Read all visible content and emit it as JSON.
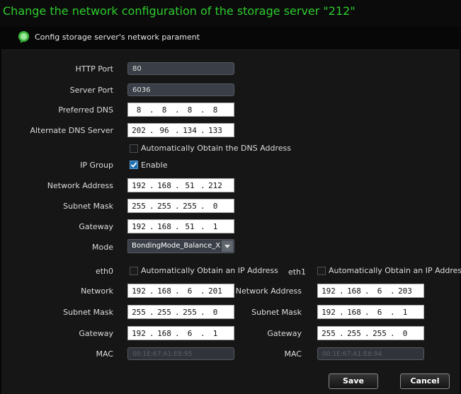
{
  "window": {
    "title": "Change the network configuration of the storage server \"212\""
  },
  "subheader": {
    "text": "Config storage server's network parament"
  },
  "form": {
    "http_port": {
      "label": "HTTP Port",
      "value": "80"
    },
    "server_port": {
      "label": "Server Port",
      "value": "6036"
    },
    "preferred_dns": {
      "label": "Preferred DNS",
      "octets": [
        "8",
        "8",
        "8",
        "8"
      ]
    },
    "alternate_dns": {
      "label": "Alternate DNS Server",
      "octets": [
        "202",
        "96",
        "134",
        "133"
      ]
    },
    "auto_dns": {
      "label": "Automatically Obtain the DNS Address",
      "checked": false
    },
    "ip_group": {
      "label": "IP Group",
      "enable_label": "Enable",
      "checked": true
    },
    "network_address": {
      "label": "Network Address",
      "octets": [
        "192",
        "168",
        "51",
        "212"
      ]
    },
    "subnet_mask": {
      "label": "Subnet Mask",
      "octets": [
        "255",
        "255",
        "255",
        "0"
      ]
    },
    "gateway": {
      "label": "Gateway",
      "octets": [
        "192",
        "168",
        "51",
        "1"
      ]
    },
    "mode": {
      "label": "Mode",
      "value": "BondingMode_Balance_X"
    }
  },
  "eth0": {
    "label": "eth0",
    "auto_ip": {
      "label": "Automatically Obtain an IP Address",
      "checked": false
    },
    "network": {
      "label": "Network",
      "octets": [
        "192",
        "168",
        "6",
        "201"
      ]
    },
    "subnet_mask": {
      "label": "Subnet Mask",
      "octets": [
        "255",
        "255",
        "255",
        "0"
      ]
    },
    "gateway": {
      "label": "Gateway",
      "octets": [
        "192",
        "168",
        "6",
        "1"
      ]
    },
    "mac": {
      "label": "MAC",
      "value": "00:1E:67:A1:E8:95"
    }
  },
  "eth1": {
    "label": "eth1",
    "auto_ip": {
      "label": "Automatically Obtain an IP Address",
      "checked": false
    },
    "network": {
      "label": "Network Address",
      "octets": [
        "192",
        "168",
        "6",
        "203"
      ]
    },
    "subnet_mask": {
      "label": "Subnet Mask",
      "octets": [
        "192",
        "168",
        "6",
        "1"
      ]
    },
    "gateway": {
      "label": "Gateway",
      "octets": [
        "255",
        "255",
        "255",
        "0"
      ]
    },
    "mac": {
      "label": "MAC",
      "value": "00:1E:67:A1:E8:94"
    }
  },
  "buttons": {
    "save": "Save",
    "cancel": "Cancel"
  },
  "colors": {
    "title": "#2ecc2e",
    "check_on": "#1e6fb0",
    "background": "#161616"
  }
}
